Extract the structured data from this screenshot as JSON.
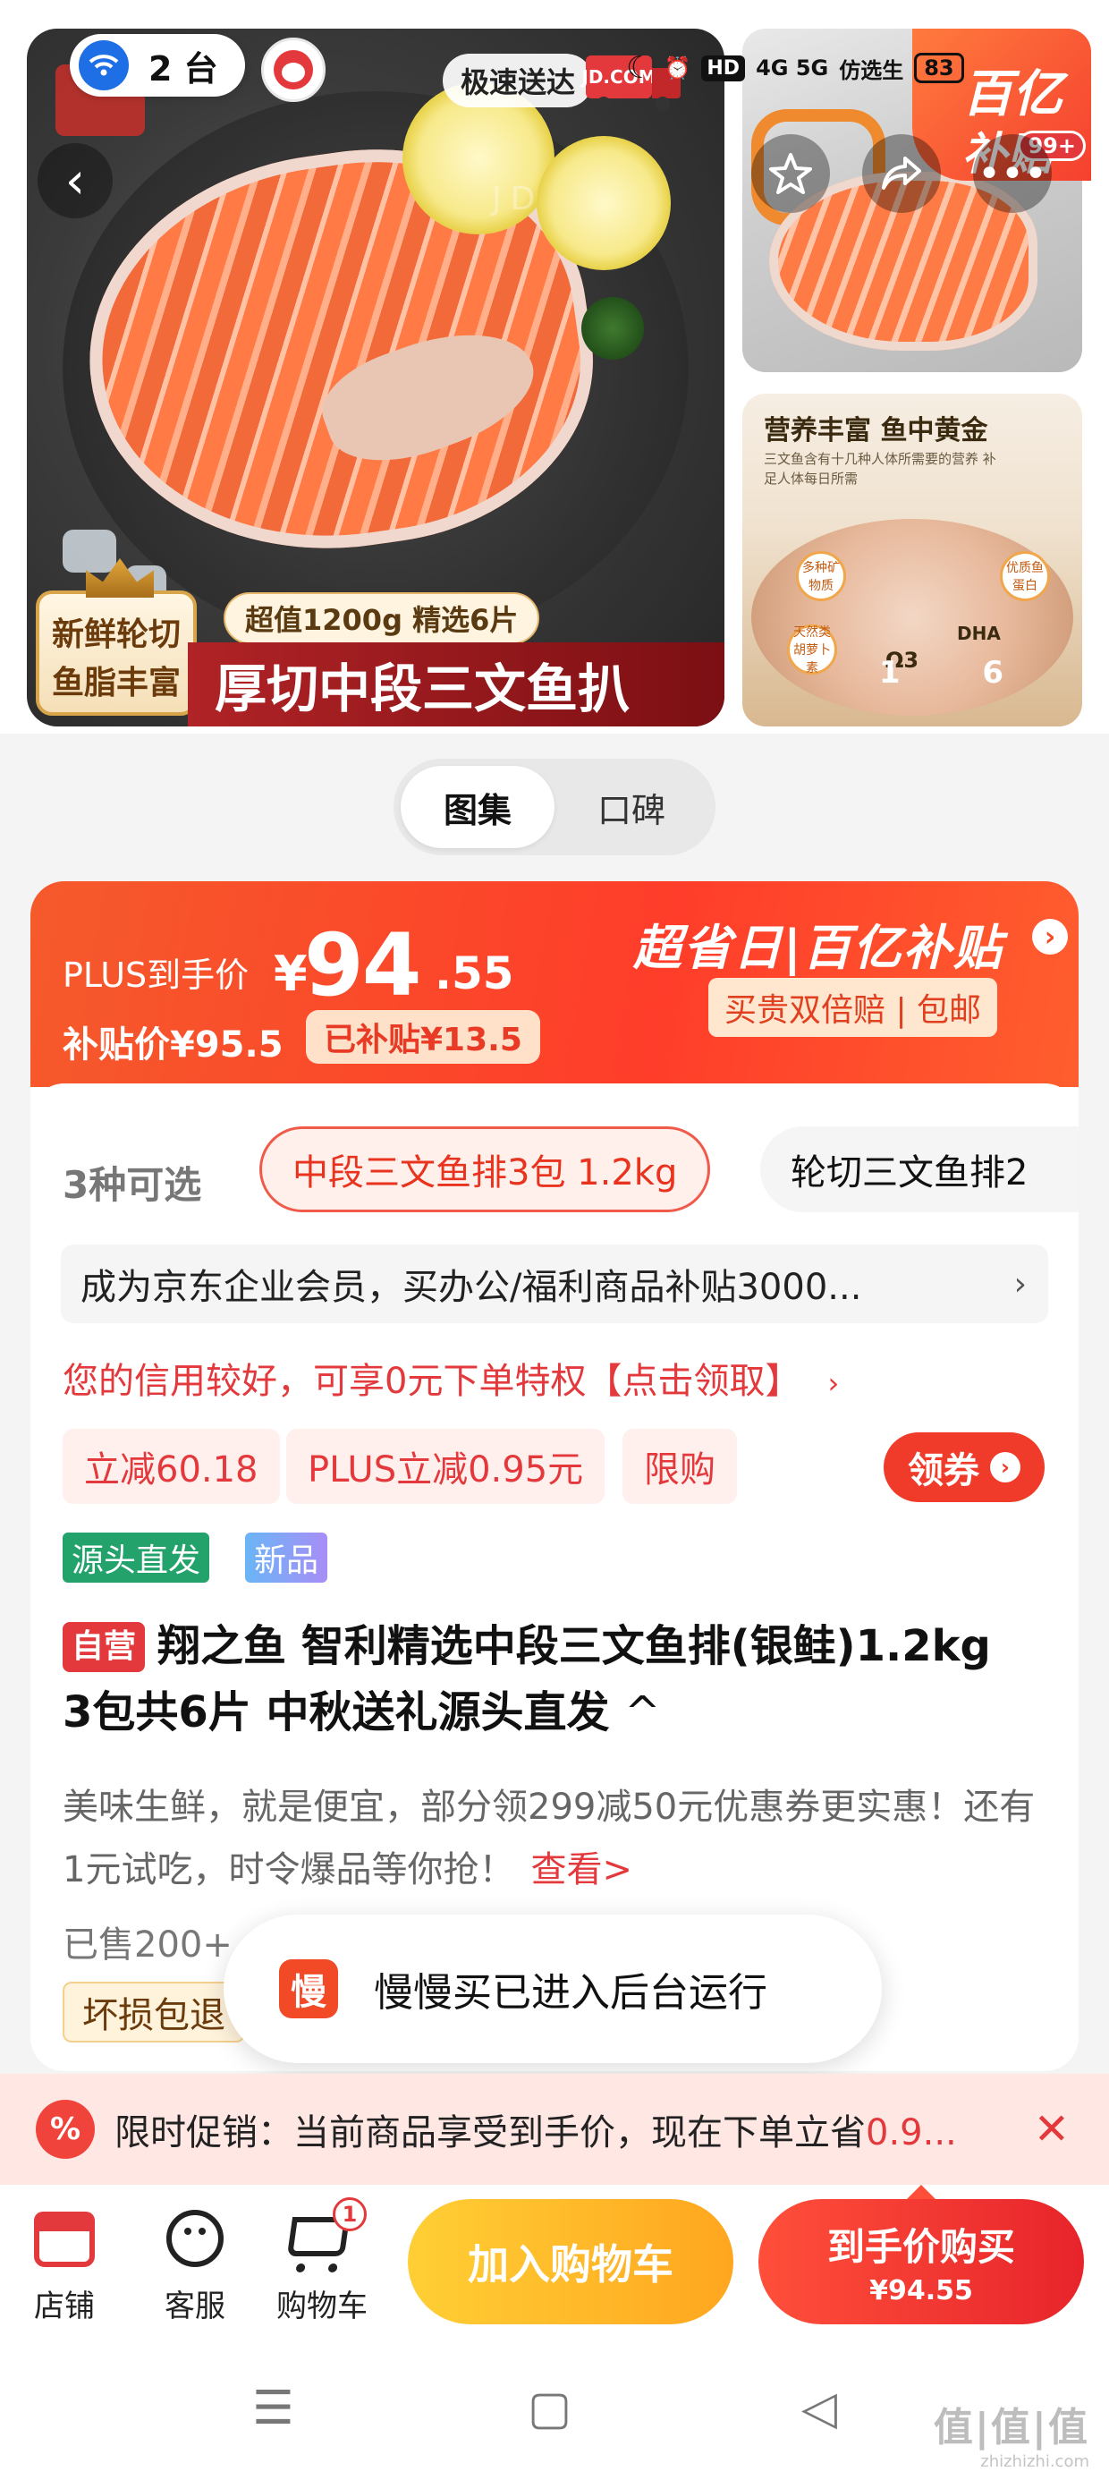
{
  "status_bar": {
    "device_count": "2 台",
    "network": "4G  5G",
    "carrier_text": "仿选生",
    "battery": "83",
    "hd_label": "HD"
  },
  "gallery": {
    "fast_delivery": "极速送达",
    "truck_text": "JD.COM",
    "value_tag": "超值1200g 精选6片",
    "badge_line1": "新鲜轮切",
    "badge_line2": "鱼脂丰富",
    "main_title": "厚切中段三文鱼扒",
    "subsidy_badge_line1": "百亿",
    "subsidy_badge_line2": "补贴",
    "subsidy_count": "99+",
    "side_b_heading": "营养丰富  鱼中黄金",
    "side_b_text": "三文鱼含有十几种人体所需要的营养 补足人体每日所需",
    "side_b_bubbles": [
      "多种矿物质",
      "优质鱼蛋白",
      "天然类胡萝卜素"
    ],
    "side_b_omega": "Ω3",
    "side_b_dha": "DHA",
    "image_counter": "1   6"
  },
  "tabs": [
    {
      "label": "图集",
      "active": true
    },
    {
      "label": "口碑",
      "active": false
    }
  ],
  "price": {
    "plus_label": "PLUS到手价",
    "currency": "¥",
    "plus_int": "94",
    "plus_dec": ".55",
    "subsidy_price_label": "补贴价¥95.5",
    "subsidized_tag": "已补贴¥13.5",
    "promo_title": "超省日|百亿补贴",
    "promo_arrow": "›",
    "promo_sub": "买贵双倍赔 | 包邮"
  },
  "options": {
    "count_label": "3种可选",
    "selected": "中段三文鱼排3包  1.2kg",
    "other": "轮切三文鱼排2"
  },
  "enterprise_row": {
    "text": "成为京东企业会员，买办公/福利商品补贴3000...",
    "chevron": "›"
  },
  "credit_line": {
    "text": "您的信用较好，可享0元下单特权【点击领取】",
    "chevron": "›"
  },
  "coupons": [
    "立减60.18",
    "PLUS立减0.95元",
    "限购"
  ],
  "claim_button": {
    "label": "领券",
    "icon": "›"
  },
  "tags": [
    "源头直发",
    "新品"
  ],
  "product": {
    "self_tag": "自营",
    "title": "翔之鱼 智利精选中段三文鱼排(银鲑)1.2kg 3包共6片 中秋送礼源头直发",
    "expand_icon": "^",
    "desc": "美味生鲜，就是便宜，部分领299减50元优惠券更实惠！还有1元试吃，时令爆品等你抢！",
    "desc_more": "查看>",
    "sold": "已售200+",
    "guarantee": "坏损包退"
  },
  "toast": {
    "icon_text": "慢",
    "message": "慢慢买已进入后台运行"
  },
  "promo_strip": {
    "icon": "%",
    "text": "限时促销：当前商品享受到手价，现在下单立省",
    "highlight": "0.9...",
    "close": "✕"
  },
  "bottom_nav": [
    {
      "label": "店铺",
      "icon": "shop-icon"
    },
    {
      "label": "客服",
      "icon": "customer-service-icon"
    },
    {
      "label": "购物车",
      "icon": "cart-icon",
      "badge": "1"
    }
  ],
  "actions": {
    "add_cart": "加入购物车",
    "buy_line1": "到手价购买",
    "buy_line2": "¥94.55"
  },
  "system_nav": {
    "menu": "☰",
    "home": "▢",
    "back": "◁"
  },
  "watermark": {
    "line1": "值|值|值",
    "line2": "zhizhizhi.com"
  },
  "colors": {
    "jd_red": "#e4393c",
    "promo_orange": "#f55a2b",
    "add_cart_yellow": "#ffb21f"
  }
}
